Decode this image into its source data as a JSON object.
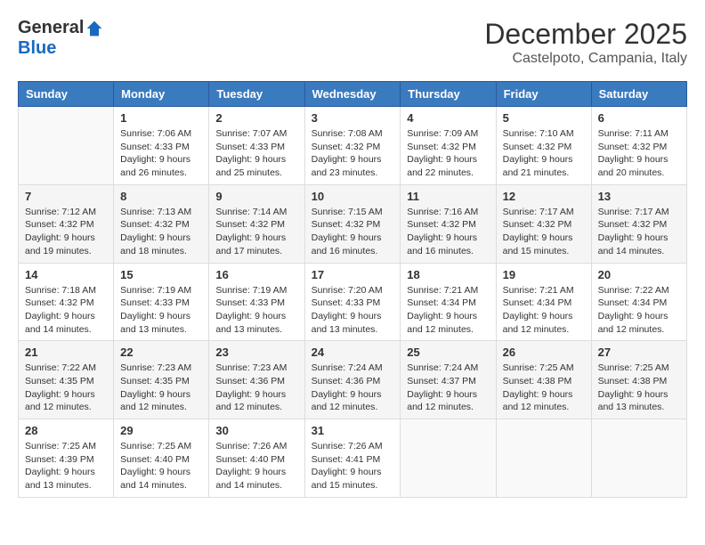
{
  "logo": {
    "general": "General",
    "blue": "Blue"
  },
  "title": "December 2025",
  "location": "Castelpoto, Campania, Italy",
  "weekdays": [
    "Sunday",
    "Monday",
    "Tuesday",
    "Wednesday",
    "Thursday",
    "Friday",
    "Saturday"
  ],
  "weeks": [
    [
      {
        "day": "",
        "sunrise": "",
        "sunset": "",
        "daylight": "",
        "empty": true
      },
      {
        "day": "1",
        "sunrise": "Sunrise: 7:06 AM",
        "sunset": "Sunset: 4:33 PM",
        "daylight": "Daylight: 9 hours and 26 minutes."
      },
      {
        "day": "2",
        "sunrise": "Sunrise: 7:07 AM",
        "sunset": "Sunset: 4:33 PM",
        "daylight": "Daylight: 9 hours and 25 minutes."
      },
      {
        "day": "3",
        "sunrise": "Sunrise: 7:08 AM",
        "sunset": "Sunset: 4:32 PM",
        "daylight": "Daylight: 9 hours and 23 minutes."
      },
      {
        "day": "4",
        "sunrise": "Sunrise: 7:09 AM",
        "sunset": "Sunset: 4:32 PM",
        "daylight": "Daylight: 9 hours and 22 minutes."
      },
      {
        "day": "5",
        "sunrise": "Sunrise: 7:10 AM",
        "sunset": "Sunset: 4:32 PM",
        "daylight": "Daylight: 9 hours and 21 minutes."
      },
      {
        "day": "6",
        "sunrise": "Sunrise: 7:11 AM",
        "sunset": "Sunset: 4:32 PM",
        "daylight": "Daylight: 9 hours and 20 minutes."
      }
    ],
    [
      {
        "day": "7",
        "sunrise": "Sunrise: 7:12 AM",
        "sunset": "Sunset: 4:32 PM",
        "daylight": "Daylight: 9 hours and 19 minutes."
      },
      {
        "day": "8",
        "sunrise": "Sunrise: 7:13 AM",
        "sunset": "Sunset: 4:32 PM",
        "daylight": "Daylight: 9 hours and 18 minutes."
      },
      {
        "day": "9",
        "sunrise": "Sunrise: 7:14 AM",
        "sunset": "Sunset: 4:32 PM",
        "daylight": "Daylight: 9 hours and 17 minutes."
      },
      {
        "day": "10",
        "sunrise": "Sunrise: 7:15 AM",
        "sunset": "Sunset: 4:32 PM",
        "daylight": "Daylight: 9 hours and 16 minutes."
      },
      {
        "day": "11",
        "sunrise": "Sunrise: 7:16 AM",
        "sunset": "Sunset: 4:32 PM",
        "daylight": "Daylight: 9 hours and 16 minutes."
      },
      {
        "day": "12",
        "sunrise": "Sunrise: 7:17 AM",
        "sunset": "Sunset: 4:32 PM",
        "daylight": "Daylight: 9 hours and 15 minutes."
      },
      {
        "day": "13",
        "sunrise": "Sunrise: 7:17 AM",
        "sunset": "Sunset: 4:32 PM",
        "daylight": "Daylight: 9 hours and 14 minutes."
      }
    ],
    [
      {
        "day": "14",
        "sunrise": "Sunrise: 7:18 AM",
        "sunset": "Sunset: 4:32 PM",
        "daylight": "Daylight: 9 hours and 14 minutes."
      },
      {
        "day": "15",
        "sunrise": "Sunrise: 7:19 AM",
        "sunset": "Sunset: 4:33 PM",
        "daylight": "Daylight: 9 hours and 13 minutes."
      },
      {
        "day": "16",
        "sunrise": "Sunrise: 7:19 AM",
        "sunset": "Sunset: 4:33 PM",
        "daylight": "Daylight: 9 hours and 13 minutes."
      },
      {
        "day": "17",
        "sunrise": "Sunrise: 7:20 AM",
        "sunset": "Sunset: 4:33 PM",
        "daylight": "Daylight: 9 hours and 13 minutes."
      },
      {
        "day": "18",
        "sunrise": "Sunrise: 7:21 AM",
        "sunset": "Sunset: 4:34 PM",
        "daylight": "Daylight: 9 hours and 12 minutes."
      },
      {
        "day": "19",
        "sunrise": "Sunrise: 7:21 AM",
        "sunset": "Sunset: 4:34 PM",
        "daylight": "Daylight: 9 hours and 12 minutes."
      },
      {
        "day": "20",
        "sunrise": "Sunrise: 7:22 AM",
        "sunset": "Sunset: 4:34 PM",
        "daylight": "Daylight: 9 hours and 12 minutes."
      }
    ],
    [
      {
        "day": "21",
        "sunrise": "Sunrise: 7:22 AM",
        "sunset": "Sunset: 4:35 PM",
        "daylight": "Daylight: 9 hours and 12 minutes."
      },
      {
        "day": "22",
        "sunrise": "Sunrise: 7:23 AM",
        "sunset": "Sunset: 4:35 PM",
        "daylight": "Daylight: 9 hours and 12 minutes."
      },
      {
        "day": "23",
        "sunrise": "Sunrise: 7:23 AM",
        "sunset": "Sunset: 4:36 PM",
        "daylight": "Daylight: 9 hours and 12 minutes."
      },
      {
        "day": "24",
        "sunrise": "Sunrise: 7:24 AM",
        "sunset": "Sunset: 4:36 PM",
        "daylight": "Daylight: 9 hours and 12 minutes."
      },
      {
        "day": "25",
        "sunrise": "Sunrise: 7:24 AM",
        "sunset": "Sunset: 4:37 PM",
        "daylight": "Daylight: 9 hours and 12 minutes."
      },
      {
        "day": "26",
        "sunrise": "Sunrise: 7:25 AM",
        "sunset": "Sunset: 4:38 PM",
        "daylight": "Daylight: 9 hours and 12 minutes."
      },
      {
        "day": "27",
        "sunrise": "Sunrise: 7:25 AM",
        "sunset": "Sunset: 4:38 PM",
        "daylight": "Daylight: 9 hours and 13 minutes."
      }
    ],
    [
      {
        "day": "28",
        "sunrise": "Sunrise: 7:25 AM",
        "sunset": "Sunset: 4:39 PM",
        "daylight": "Daylight: 9 hours and 13 minutes."
      },
      {
        "day": "29",
        "sunrise": "Sunrise: 7:25 AM",
        "sunset": "Sunset: 4:40 PM",
        "daylight": "Daylight: 9 hours and 14 minutes."
      },
      {
        "day": "30",
        "sunrise": "Sunrise: 7:26 AM",
        "sunset": "Sunset: 4:40 PM",
        "daylight": "Daylight: 9 hours and 14 minutes."
      },
      {
        "day": "31",
        "sunrise": "Sunrise: 7:26 AM",
        "sunset": "Sunset: 4:41 PM",
        "daylight": "Daylight: 9 hours and 15 minutes."
      },
      {
        "day": "",
        "sunrise": "",
        "sunset": "",
        "daylight": "",
        "empty": true
      },
      {
        "day": "",
        "sunrise": "",
        "sunset": "",
        "daylight": "",
        "empty": true
      },
      {
        "day": "",
        "sunrise": "",
        "sunset": "",
        "daylight": "",
        "empty": true
      }
    ]
  ]
}
